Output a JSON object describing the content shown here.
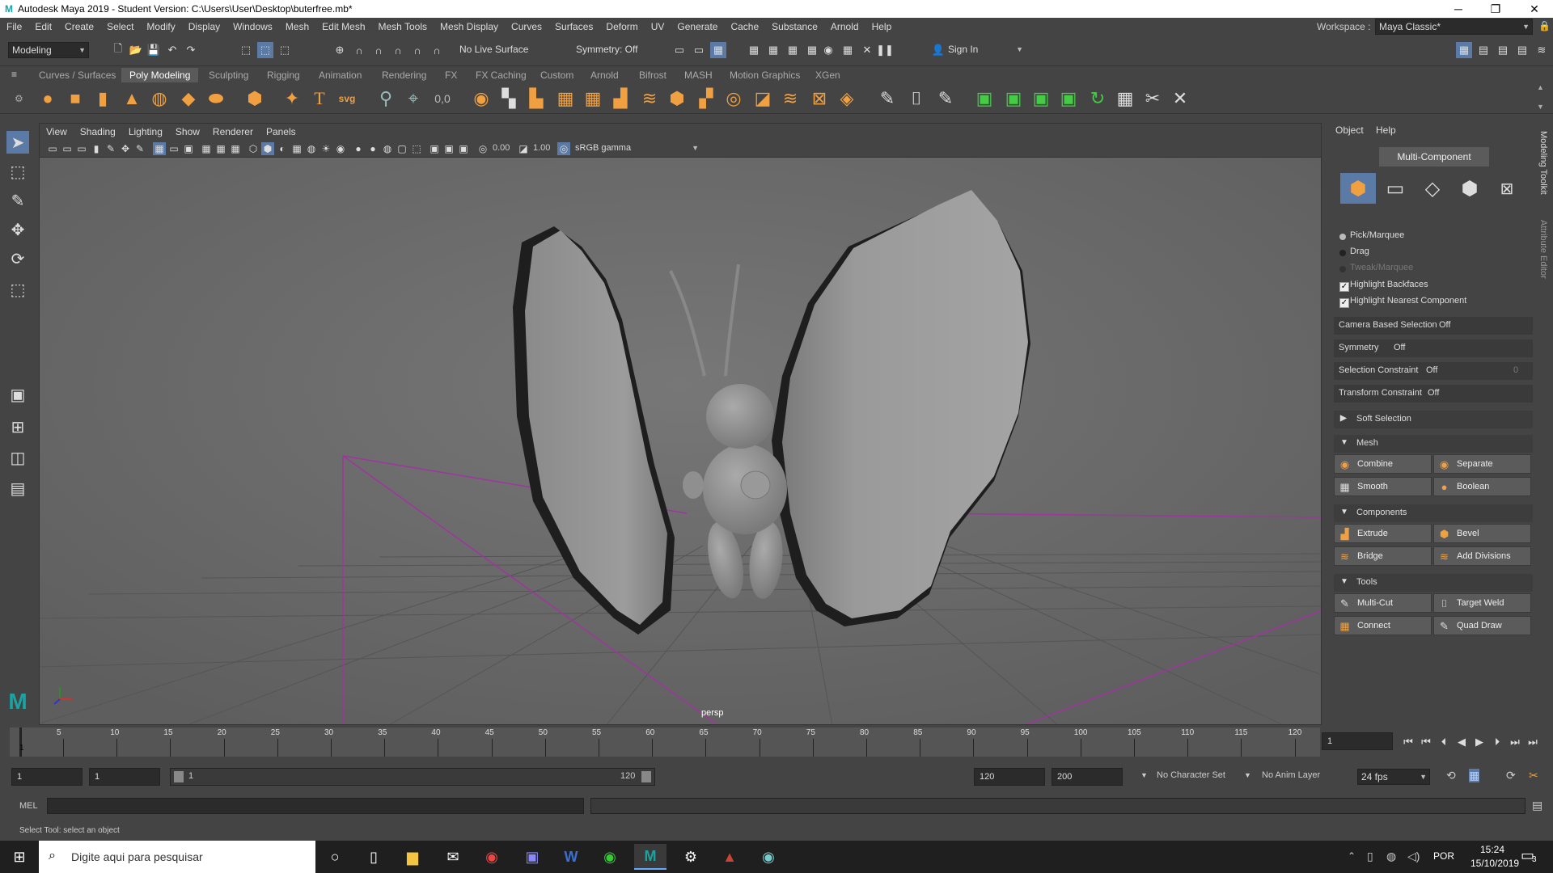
{
  "window": {
    "title": "Autodesk Maya 2019 - Student Version: C:\\Users\\User\\Desktop\\buterfree.mb*",
    "minimize": "─",
    "maximize": "❐",
    "close": "✕"
  },
  "menubar": {
    "items": [
      "File",
      "Edit",
      "Create",
      "Select",
      "Modify",
      "Display",
      "Windows",
      "Mesh",
      "Edit Mesh",
      "Mesh Tools",
      "Mesh Display",
      "Curves",
      "Surfaces",
      "Deform",
      "UV",
      "Generate",
      "Cache",
      "Substance",
      "Arnold",
      "Help"
    ],
    "workspace_label": "Workspace :",
    "workspace_value": "Maya Classic*"
  },
  "statusline": {
    "menuset": "Modeling",
    "live_surface": "No Live Surface",
    "symmetry": "Symmetry: Off",
    "sign_in": "Sign In"
  },
  "shelf": {
    "tabs": [
      "Curves / Surfaces",
      "Poly Modeling",
      "Sculpting",
      "Rigging",
      "Animation",
      "Rendering",
      "FX",
      "FX Caching",
      "Custom",
      "Arnold",
      "Bifrost",
      "MASH",
      "Motion Graphics",
      "XGen"
    ],
    "active_tab": "Poly Modeling",
    "text_tool_glyph": "T",
    "svg_tool_label": "svg"
  },
  "viewport": {
    "menus": [
      "View",
      "Shading",
      "Lighting",
      "Show",
      "Renderer",
      "Panels"
    ],
    "exposure": "0.00",
    "gamma": "1.00",
    "color_space": "sRGB gamma",
    "camera_label": "persp"
  },
  "right_panel": {
    "tabs": [
      "Object",
      "Help"
    ],
    "header": "Multi-Component",
    "pick_modes": [
      {
        "label": "Pick/Marquee",
        "enabled": true
      },
      {
        "label": "Drag",
        "enabled": true
      },
      {
        "label": "Tweak/Marquee",
        "enabled": false
      }
    ],
    "checks": [
      {
        "label": "Highlight Backfaces",
        "checked": true
      },
      {
        "label": "Highlight Nearest Component",
        "checked": true
      }
    ],
    "props": [
      {
        "label": "Camera Based Selection",
        "value": "Off"
      },
      {
        "label": "Symmetry",
        "value": "Off"
      },
      {
        "label": "Selection Constraint",
        "value": "Off",
        "extra": "0"
      },
      {
        "label": "Transform Constraint",
        "value": "Off"
      }
    ],
    "soft_selection": "Soft Selection",
    "sections": [
      {
        "title": "Mesh",
        "buttons": [
          "Combine",
          "Separate",
          "Smooth",
          "Boolean"
        ]
      },
      {
        "title": "Components",
        "buttons": [
          "Extrude",
          "Bevel",
          "Bridge",
          "Add Divisions"
        ]
      },
      {
        "title": "Tools",
        "buttons": [
          "Multi-Cut",
          "Target Weld",
          "Connect",
          "Quad Draw"
        ]
      }
    ],
    "vertical_tabs": [
      "Modeling Toolkit",
      "Attribute Editor"
    ]
  },
  "timeline": {
    "ticks": [
      "5",
      "10",
      "15",
      "20",
      "25",
      "30",
      "35",
      "40",
      "45",
      "50",
      "55",
      "60",
      "65",
      "70",
      "75",
      "80",
      "85",
      "90",
      "95",
      "100",
      "105",
      "110",
      "115",
      "120"
    ],
    "current_frame_marker": "1",
    "current_frame": "1",
    "start_max": "1",
    "start": "1",
    "slider_start": "1",
    "slider_end": "120",
    "end": "120",
    "end_max": "200",
    "character_set": "No Character Set",
    "anim_layer": "No Anim Layer",
    "fps": "24 fps"
  },
  "mel": {
    "label": "MEL"
  },
  "help_line": "Select Tool: select an object",
  "taskbar": {
    "search_placeholder": "Digite aqui para pesquisar",
    "language": "POR",
    "time": "15:24",
    "date": "15/10/2019",
    "notification_count": "3"
  }
}
